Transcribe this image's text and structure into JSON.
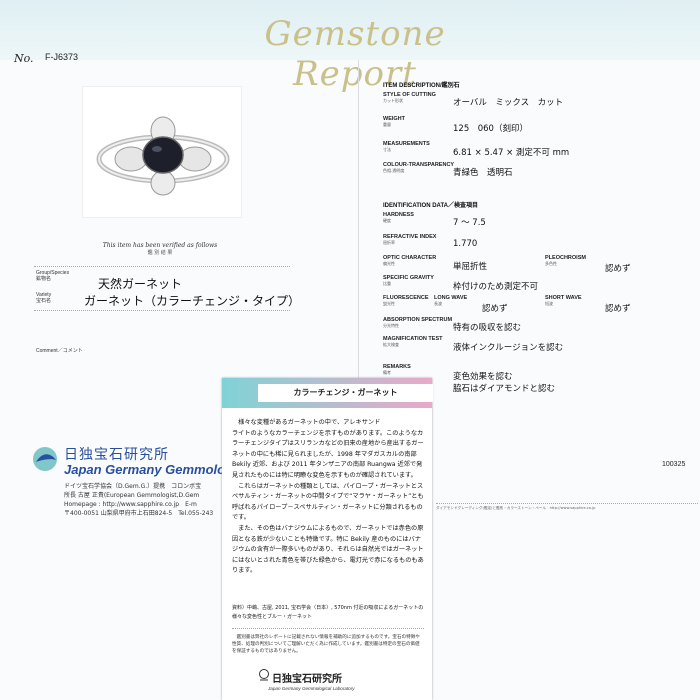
{
  "report_title": "Gemstone Report",
  "number_label": "No.",
  "number_value": "F-J6373",
  "photo_caption": "鑑 別 結 果",
  "verified_text": "This item has been verified as follows",
  "group_label": "Group/Species",
  "group_sub": "鉱物名",
  "group_value": "天然ガーネット",
  "variety_label": "Variety",
  "variety_sub": "宝石名",
  "variety_value": "ガーネット（カラーチェンジ・タイプ）",
  "comment_label": "Comment",
  "comment_sub": "／コメント",
  "item_desc_header": "ITEM DESCRIPTION/鑑別石",
  "style_label": "STYLE OF CUTTING",
  "style_sub": "カット形状",
  "style_value": "オーバル　ミックス　カット",
  "weight_label": "WEIGHT",
  "weight_sub": "重量",
  "weight_value": "125　060（刻印）",
  "meas_label": "MEASUREMENTS",
  "meas_sub": "寸法",
  "meas_value": "6.81 × 5.47 × 測定不可 mm",
  "colour_label": "COLOUR-TRANSPARENCY",
  "colour_sub": "色相-透明度",
  "colour_value": "青緑色　透明石",
  "ident_header": "IDENTIFICATION DATA／検査項目",
  "hardness_label": "HARDNESS",
  "hardness_sub": "硬度",
  "hardness_value": "7 ～ 7.5",
  "ri_label": "REFRACTIVE INDEX",
  "ri_sub": "屈折率",
  "ri_value": "1.770",
  "optic_label": "OPTIC CHARACTER",
  "optic_sub": "偏光性",
  "optic_value": "単屈折性",
  "pleo_label": "PLEOCHROISM",
  "pleo_sub": "多色性",
  "pleo_value": "認めず",
  "sg_label": "SPECIFIC GRAVITY",
  "sg_sub": "比重",
  "sg_value": "枠付けのため測定不可",
  "fluor_label": "FLUORESCENCE",
  "fluor_sub": "蛍光性",
  "lw_label": "LONG WAVE",
  "lw_sub": "長波",
  "lw_value": "認めず",
  "sw_label": "SHORT WAVE",
  "sw_sub": "短波",
  "sw_value": "認めず",
  "abs_label": "ABSORPTION SPECTRUM",
  "abs_sub": "分光特性",
  "abs_value": "特有の吸収を認む",
  "mag_label": "MAGNIFICATION TEST",
  "mag_sub": "拡大検査",
  "mag_value": "液体インクルージョンを認む",
  "remarks_label": "REMARKS",
  "remarks_sub": "備考",
  "remarks_line1": "変色効果を認む",
  "remarks_line2": "脇石はダイアモンドと認む",
  "serial": "100325",
  "footer_small": "ダイアモンドグレーディング(鑑定)と鑑別・カラーストーン・ペール　http://www.sapphire.co.jp",
  "lab_name_jp": "日独宝石研究所",
  "lab_name_en": "Japan Germany Gemmologi",
  "lab_line1": "ドイツ宝石学協会（D.Gem.G.）提携　コロンボ宝",
  "lab_line2": "所長 古屋 正貴(European Gemmologist,D.Gem",
  "lab_line3": "Homepage : http://www.sapphire.co.jp　E-m",
  "lab_line4": "〒400-0051 山梨県甲府市上石田824-5　Tel.055-243",
  "card_title": "カラーチェンジ・ガーネット",
  "card_body": "　様々な変種があるガーネットの中で、アレキサンド\nライトのようなカラーチェンジを示すものがあります。このようなカラーチェンジタイプはスリランカなどの旧来の産地から産出するガーネットの中にも稀に見られましたが、1998 年マダガスカルの南部 Bekily 近郊、および 2011 年タンザニアの南部 Ruangwa 近郊で発見されたものには特に明瞭な変色を示すものが確認されています。\n　これらはガーネットの種類としては、パイロープ・ガーネットとスペサルティン・ガーネットの中間タイプで“マラヤ・ガーネット”とも呼ばれるパイロープ－スペサルティン・ガーネットに分類されるものです。\n　また、その色はバナジウムによるもので、ガーネットでは赤色の原因となる鉄が少ないことも特徴です。特に Bekily 産のものにはバナジウムの含有が一際多いものがあり、それらは自然光ではガーネットにはないとされた青色を帯びた緑色から、電灯光で赤になるものもあります。",
  "card_ref": "資料）中嶋、古屋, 2011, 宝石学会（日本）, 570nm 付近の吸収によるガーネットの様々な変色性とブルー・ガーネット",
  "card_note": "　鑑別書は弊社のレポートに記載されない情報を補助的に追加するものです。宝石の特徴や性質、処理の判別についてご理解いただく為に作成しています。鑑別書は特定の宝石の価値を保証するものではありません。",
  "card_lab_jp": "日独宝石研究所",
  "card_lab_en": "Japan Germany Gemmological Laboratory",
  "colors": {
    "title_gold": "#c9c08a",
    "lab_blue": "#2a4fa0",
    "band_teal": "#7fd3d6",
    "band_pink": "#e9a9c8"
  }
}
